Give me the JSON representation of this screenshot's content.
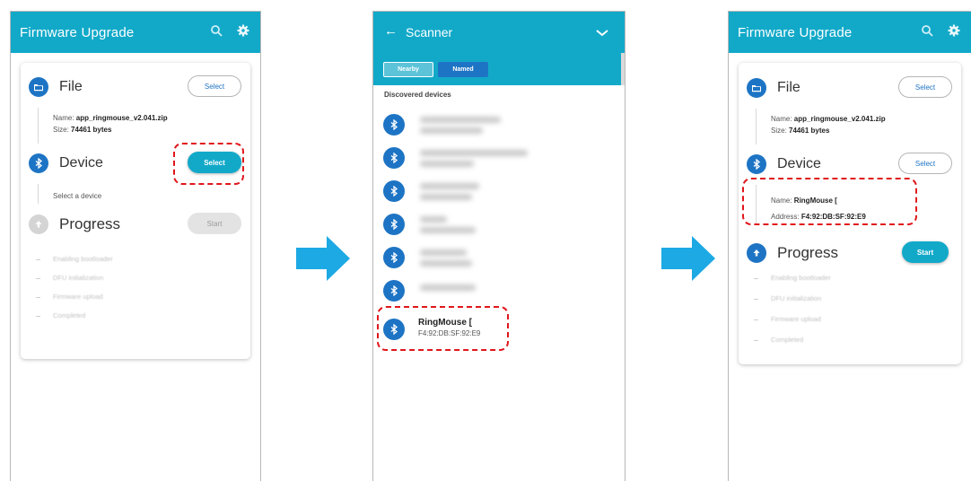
{
  "screen1": {
    "title": "Firmware Upgrade",
    "file": {
      "label": "File",
      "select_label": "Select",
      "name_key": "Name:",
      "name_value": "app_ringmouse_v2.041.zip",
      "size_key": "Size:",
      "size_value": "74461 bytes"
    },
    "device": {
      "label": "Device",
      "select_label": "Select",
      "hint": "Select a device"
    },
    "progress": {
      "label": "Progress",
      "start_label": "Start",
      "steps": [
        "Enabling bootloader",
        "DFU initialization",
        "Firmware upload",
        "Completed"
      ]
    }
  },
  "screen2": {
    "title": "Scanner",
    "tabs": [
      "Nearby",
      "Named"
    ],
    "section_title": "Discovered devices",
    "selected_device": {
      "name": "RingMouse [",
      "address": "F4:92:DB:SF:92:E9"
    }
  },
  "screen3": {
    "title": "Firmware Upgrade",
    "file": {
      "label": "File",
      "select_label": "Select",
      "name_key": "Name:",
      "name_value": "app_ringmouse_v2.041.zip",
      "size_key": "Size:",
      "size_value": "74461 bytes"
    },
    "device": {
      "label": "Device",
      "select_label": "Select",
      "name_key": "Name:",
      "name_value": "RingMouse [",
      "address_key": "Address:",
      "address_value": "F4:92:DB:SF:92:E9"
    },
    "progress": {
      "label": "Progress",
      "start_label": "Start",
      "steps": [
        "Enabling bootloader",
        "DFU initialization",
        "Firmware upload",
        "Completed"
      ]
    }
  },
  "colors": {
    "primary": "#12a9c9",
    "icon_blue": "#1e74c4",
    "highlight": "#e0161b",
    "arrow": "#1da9e4"
  },
  "icons": {
    "search": "search-icon",
    "settings": "gear-icon",
    "folder": "folder-icon",
    "bluetooth": "bluetooth-icon",
    "upload": "upload-icon",
    "arrow": "arrow-right-icon"
  }
}
